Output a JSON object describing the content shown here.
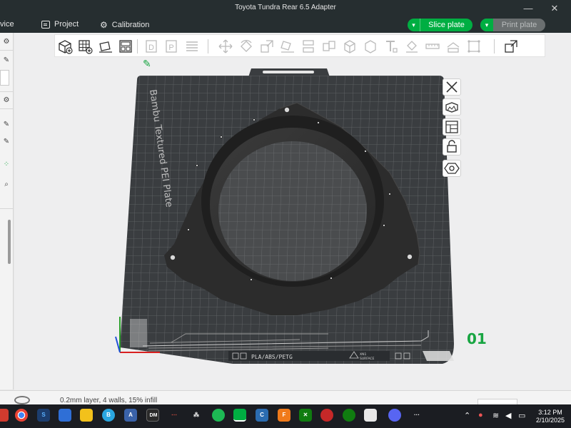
{
  "window": {
    "title": "Toyota Tundra Rear 6.5 Adapter",
    "minimize": "—",
    "close": "✕"
  },
  "menubar": {
    "device_label": "vice",
    "project_label": "Project",
    "calibration_label": "Calibration",
    "slice_label": "Slice plate",
    "print_label": "Print plate"
  },
  "plate": {
    "name": "Bambu Textured PEI Plate",
    "number": "01",
    "materials": "PLA/ABS/PETG",
    "surface_line1": "XN1",
    "surface_line2": "SURFACE"
  },
  "status": {
    "text": "0.2mm layer, 4 walls, 15% infill"
  },
  "clock": {
    "time": "3:12 PM",
    "date": "2/10/2025"
  },
  "colors": {
    "accent": "#00ae42",
    "bed": "#3a3d40",
    "model": "#2b2b2b",
    "titlebar": "#262e30"
  },
  "toolbar_icons": [
    "add-cube-icon",
    "grid-plate-icon",
    "orient-icon",
    "arrange-icon",
    "plate-d-icon",
    "plate-p-icon",
    "layers-icon",
    "move-icon",
    "rotate-icon",
    "scale-icon",
    "lay-on-face-icon",
    "cut-icon",
    "split-icon",
    "support-paint-icon",
    "assembly-icon",
    "text-icon",
    "paint-icon",
    "measure-icon",
    "seam-icon",
    "boolean-icon",
    "variable-height-icon"
  ],
  "side_tool_icons": [
    "close-view-icon",
    "isometric-view-icon",
    "plate-layout-icon",
    "lock-icon",
    "gear-hex-icon"
  ],
  "taskbar_icons": [
    "chrome-icon",
    "s-app-icon",
    "notes-icon",
    "file-explorer-icon",
    "b-app-icon",
    "a-app-icon",
    "dm-app-icon",
    "nav-app-icon",
    "tidal-icon",
    "spotify-icon",
    "bambu-studio-icon",
    "c-app-icon",
    "fusion-icon",
    "xbox-icon",
    "helmet-icon",
    "xbox-notify-icon",
    "store-icon",
    "discord-icon",
    "more-icon"
  ]
}
